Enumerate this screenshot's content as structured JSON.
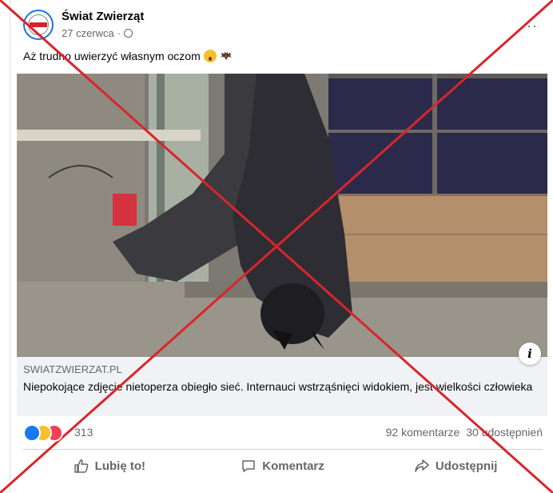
{
  "post": {
    "page_name": "Świat Zwierząt",
    "date": "27 czerwca",
    "date_separator": "·",
    "text": "Aż trudno uwierzyć własnym oczom",
    "more_label": "···"
  },
  "link_preview": {
    "domain": "SWIATZWIERZAT.PL",
    "title": "Niepokojące zdjęcie nietoperza obiegło sieć. Internauci wstrząśnięci widokiem, jest wielkości człowieka",
    "info_label": "i"
  },
  "reactions": {
    "icons": [
      "like-reaction-icon",
      "wow-reaction-icon",
      "love-reaction-icon"
    ],
    "count": "313",
    "comments": "92 komentarze",
    "shares": "30 udostępnień"
  },
  "actions": {
    "like": "Lubię to!",
    "comment": "Komentarz",
    "share": "Udostępnij"
  },
  "colors": {
    "accent": "#1877f2",
    "overlay_cross": "#d9252b",
    "text_secondary": "#65676b"
  }
}
